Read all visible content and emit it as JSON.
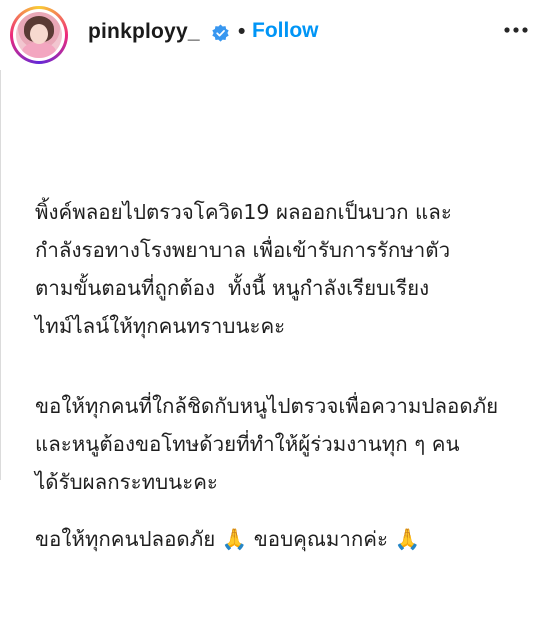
{
  "post": {
    "username": "pinkployy_",
    "separator": "•",
    "follow_label": "Follow",
    "verified_icon": "verified-badge-icon",
    "more_icon": "more-options-icon",
    "accent_color": "#0095f6",
    "verified_color": "#3897f0"
  },
  "caption": {
    "p1": {
      "l1": "พิ้งค์พลอยไปตรวจโควิด19 ผลออกเป็นบวก และ",
      "l2": "กำลังรอทางโรงพยาบาล เพื่อเข้ารับการรักษาตัว",
      "l3": "ตามขั้นตอนที่ถูกต้อง  ทั้งนี้ หนูกำลังเรียบเรียง",
      "l4": "ไทม์ไลน์ให้ทุกคนทราบนะคะ"
    },
    "p2": {
      "l1": "ขอให้ทุกคนที่ใกล้ชิดกับหนูไปตรวจเพื่อความปลอดภัย",
      "l2": "และหนูต้องขอโทษด้วยที่ทำให้ผู้ร่วมงานทุก ๆ คน",
      "l3": "ได้รับผลกระทบนะคะ"
    },
    "p3": {
      "l1": "ขอให้ทุกคนปลอดภัย 🙏 ขอบคุณมากค่ะ 🙏"
    }
  }
}
